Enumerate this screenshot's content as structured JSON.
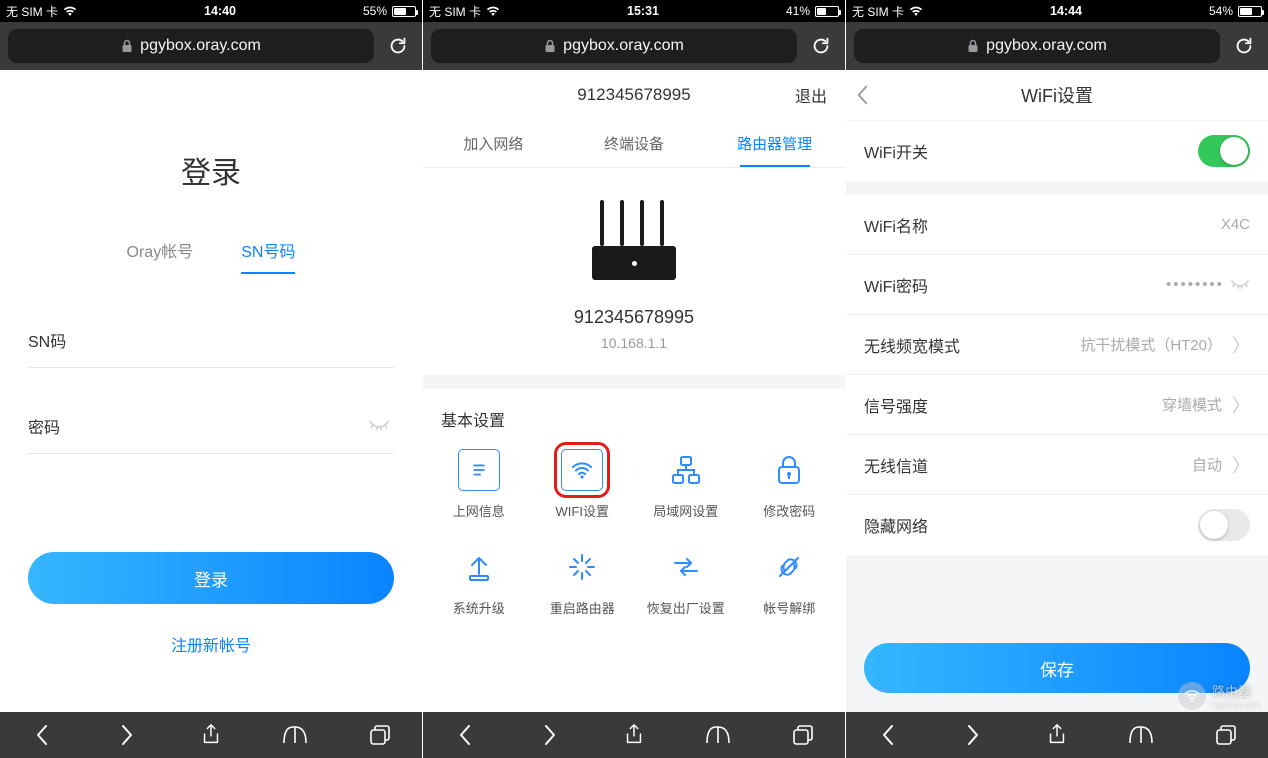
{
  "url": "pgybox.oray.com",
  "screens": [
    {
      "status": {
        "carrier": "无 SIM 卡",
        "time": "14:40",
        "battery_pct": "55%",
        "battery_fill": 55
      },
      "title": "登录",
      "tabs": [
        {
          "label": "Oray帐号",
          "active": false
        },
        {
          "label": "SN号码",
          "active": true
        }
      ],
      "fields": {
        "sn_label": "SN码",
        "pwd_label": "密码"
      },
      "login_button": "登录",
      "register_link": "注册新帐号"
    },
    {
      "status": {
        "carrier": "无 SIM 卡",
        "time": "15:31",
        "battery_pct": "41%",
        "battery_fill": 41
      },
      "header": {
        "sn": "912345678995",
        "logout": "退出"
      },
      "tabs": [
        {
          "label": "加入网络",
          "active": false
        },
        {
          "label": "终端设备",
          "active": false
        },
        {
          "label": "路由器管理",
          "active": true
        }
      ],
      "device": {
        "sn": "912345678995",
        "ip": "10.168.1.1"
      },
      "section_title": "基本设置",
      "grid": [
        {
          "label": "上网信息",
          "icon": "info"
        },
        {
          "label": "WIFI设置",
          "icon": "wifi",
          "highlight": true
        },
        {
          "label": "局域网设置",
          "icon": "lan"
        },
        {
          "label": "修改密码",
          "icon": "lock"
        },
        {
          "label": "系统升级",
          "icon": "upgrade"
        },
        {
          "label": "重启路由器",
          "icon": "restart"
        },
        {
          "label": "恢复出厂设置",
          "icon": "reset"
        },
        {
          "label": "帐号解绑",
          "icon": "unbind"
        }
      ]
    },
    {
      "status": {
        "carrier": "无 SIM 卡",
        "time": "14:44",
        "battery_pct": "54%",
        "battery_fill": 54
      },
      "header_title": "WiFi设置",
      "rows": {
        "wifi_switch": {
          "label": "WiFi开关",
          "on": true
        },
        "wifi_name": {
          "label": "WiFi名称",
          "value": "X4C"
        },
        "wifi_pwd": {
          "label": "WiFi密码",
          "value": "••••••••"
        },
        "bw_mode": {
          "label": "无线频宽模式",
          "value": "抗干扰模式（HT20）"
        },
        "signal": {
          "label": "信号强度",
          "value": "穿墙模式"
        },
        "channel": {
          "label": "无线信道",
          "value": "自动"
        },
        "hide": {
          "label": "隐藏网络",
          "on": false
        }
      },
      "save_button": "保存"
    }
  ],
  "watermark": {
    "text": "路由器",
    "sub": "luyouqi.com"
  }
}
